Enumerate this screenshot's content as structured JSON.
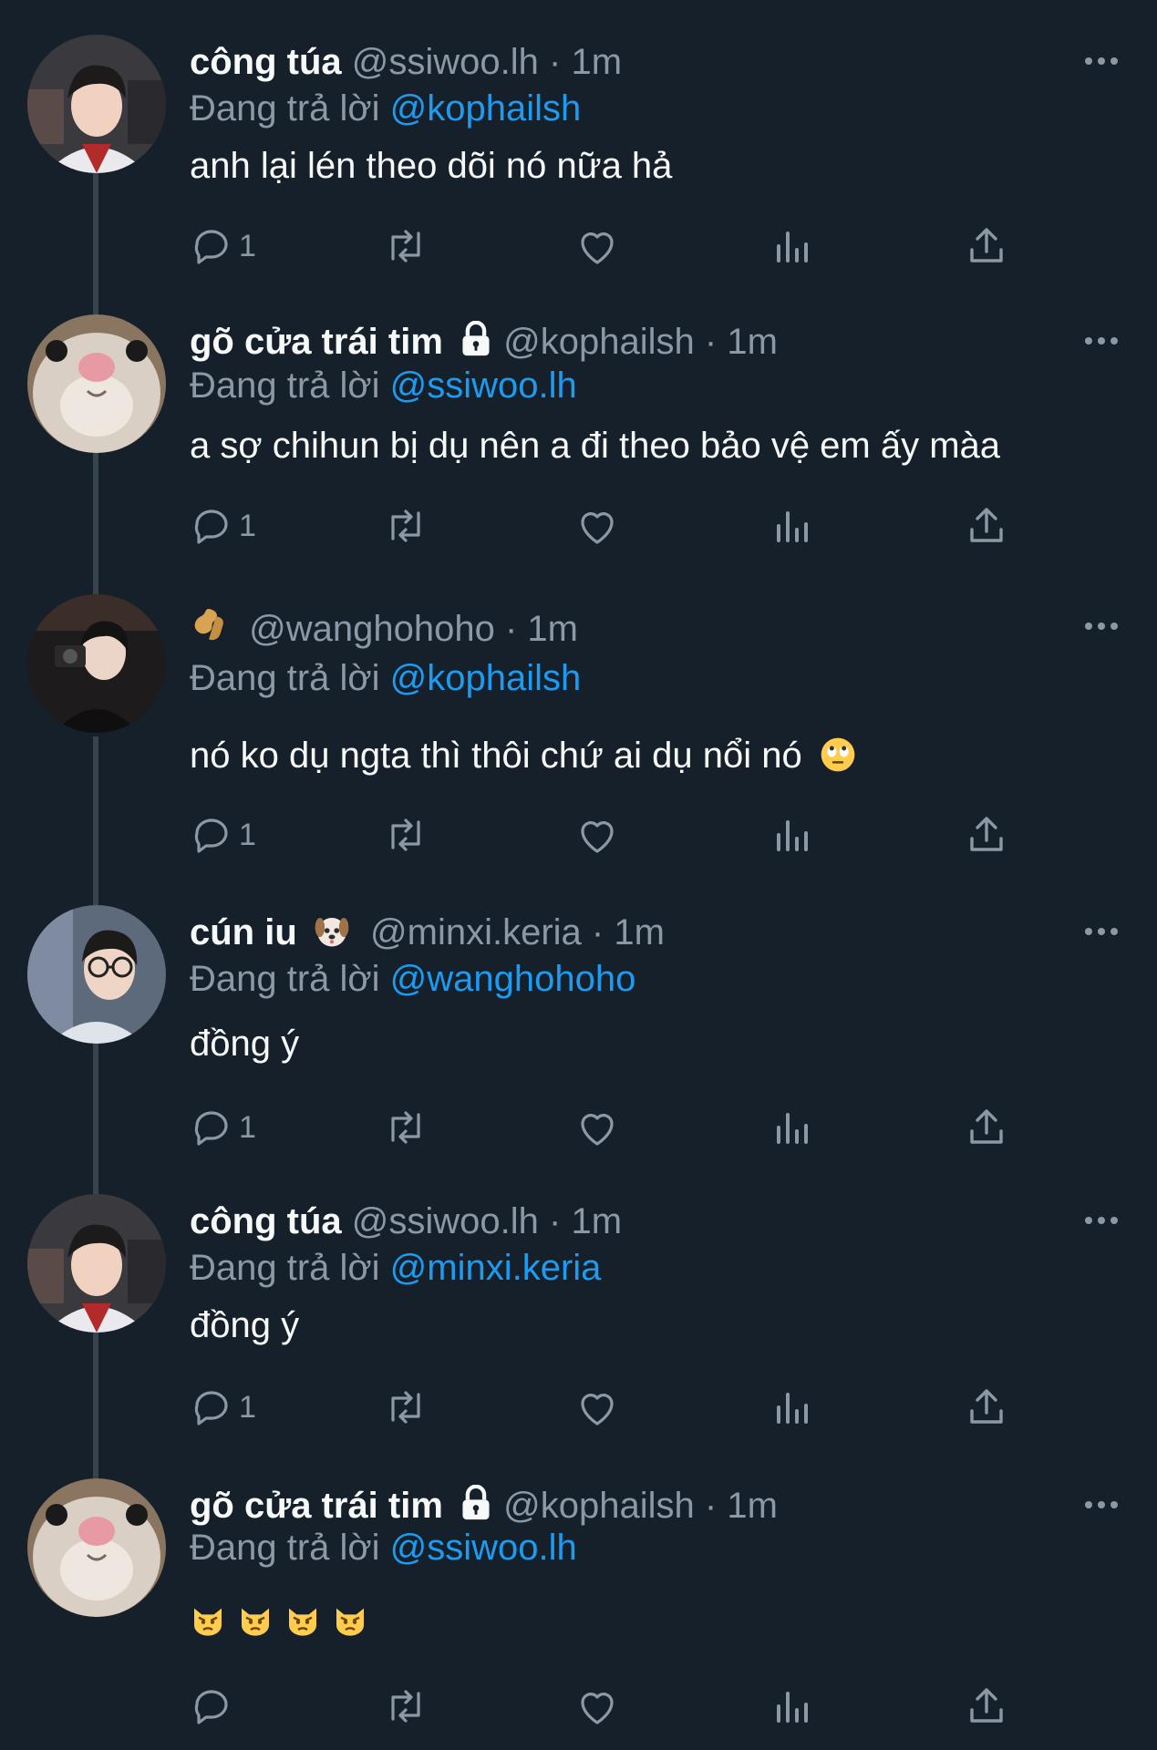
{
  "colors": {
    "background": "#15202b",
    "text_primary": "#f7f9f9",
    "text_secondary": "#8b98a5",
    "accent": "#1d9bf0",
    "thread_line": "#38444d"
  },
  "replies": [
    {
      "display_name": "công túa",
      "handle": "@ssiwoo.lh",
      "time": "· 1m",
      "replying_prefix": "Đang trả lời",
      "replying_to": "@kophailsh",
      "text": "anh lại lén theo dõi nó nữa hả",
      "reply_count": "1",
      "avatar": "person-avatar-icon"
    },
    {
      "display_name": "gõ cửa trái tim",
      "name_badge": "lock-icon",
      "handle": "@kophailsh",
      "time": "· 1m",
      "replying_prefix": "Đang trả lời",
      "replying_to": "@ssiwoo.lh",
      "text": "a sợ chihun bị dụ nên a đi theo bảo vệ em ấy màa",
      "reply_count": "1",
      "avatar": "hamster-avatar-icon"
    },
    {
      "display_name_emoji": "peanut-icon",
      "handle": "@wanghohoho",
      "time": "· 1m",
      "replying_prefix": "Đang trả lời",
      "replying_to": "@kophailsh",
      "text": "nó ko dụ ngta thì thôi chứ ai dụ nổi nó",
      "text_emoji": "eye-roll-emoji",
      "reply_count": "1",
      "avatar": "camera-person-avatar-icon"
    },
    {
      "display_name": "cún iu",
      "name_badge": "dog-face-emoji",
      "handle": "@minxi.keria",
      "time": "· 1m",
      "replying_prefix": "Đang trả lời",
      "replying_to": "@wanghohoho",
      "text": "đồng ý",
      "reply_count": "1",
      "avatar": "glasses-person-avatar-icon"
    },
    {
      "display_name": "công túa",
      "handle": "@ssiwoo.lh",
      "time": "· 1m",
      "replying_prefix": "Đang trả lời",
      "replying_to": "@minxi.keria",
      "text": "đồng ý",
      "reply_count": "1",
      "avatar": "person-avatar-icon"
    },
    {
      "display_name": "gõ cửa trái tim",
      "name_badge": "lock-icon",
      "handle": "@kophailsh",
      "time": "· 1m",
      "replying_prefix": "Đang trả lời",
      "replying_to": "@ssiwoo.lh",
      "text_emojis": [
        "pouting-cat-emoji",
        "pouting-cat-emoji",
        "pouting-cat-emoji",
        "pouting-cat-emoji"
      ],
      "reply_count": "",
      "avatar": "hamster-avatar-icon"
    }
  ]
}
